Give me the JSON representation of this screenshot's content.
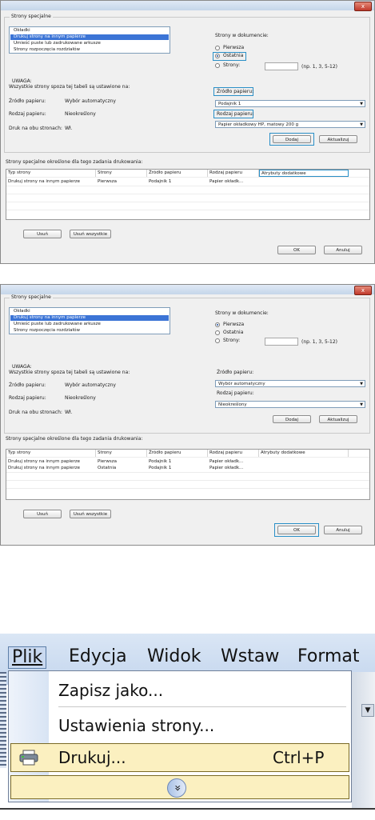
{
  "dialog": {
    "group_title": "Strony specjalne",
    "list_items": [
      "Okładki",
      "Drukuj strony na innym papierze",
      "Umieść puste lub zadrukowane arkusze",
      "Strony rozpoczęcia rozdziałów"
    ],
    "selected_index": 1,
    "pages_label": "Strony w dokumencie:",
    "radio_first": "Pierwsza",
    "radio_last": "Ostatnia",
    "radio_pages": "Strony:",
    "pages_hint": "(np. 1, 3, 5-12)",
    "note_title": "UWAGA:",
    "note_text": "Wszystkie strony spoza tej tabeli są ustawione na:",
    "source_label": "Źródło papieru:",
    "source_value": "Wybór automatyczny",
    "type_label": "Rodzaj papieru:",
    "type_value": "Nieokreślony",
    "duplex_label": "Druk na obu stronach:",
    "duplex_value": "Wł.",
    "paper_source_label": "Źródło papieru:",
    "paper_type_label": "Rodzaj papieru:",
    "add_button": "Dodaj",
    "update_button": "Aktualizuj",
    "table_caption": "Strony specjalne określone dla tego zadania drukowania:",
    "columns": [
      "Typ strony",
      "Strony",
      "Źródło papieru",
      "Rodzaj papieru",
      "Atrybuty dodatkowe"
    ],
    "remove_button": "Usuń",
    "remove_all_button": "Usuń wszystkie",
    "ok_button": "OK",
    "cancel_button": "Anuluj",
    "close_glyph": "x"
  },
  "dialog1": {
    "selected_radio": "Ostatnia",
    "source_combo": "Podajnik 1",
    "type_combo": "Papier okładkowy HP, matowy 200 g",
    "rows": [
      [
        "Drukuj strony na innym papierze",
        "Pierwsza",
        "Podajnik 1",
        "Papier okładk..."
      ]
    ]
  },
  "dialog2": {
    "selected_radio": "Pierwsza",
    "source_combo": "Wybór automatyczny",
    "type_combo": "Nieokreślony",
    "rows": [
      [
        "Drukuj strony na innym papierze",
        "Pierwsza",
        "Podajnik 1",
        "Papier okładk..."
      ],
      [
        "Drukuj strony na innym papierze",
        "Ostatnia",
        "Podajnik 1",
        "Papier okładk..."
      ]
    ]
  },
  "menu": {
    "bar_items": [
      "Plik",
      "Edycja",
      "Widok",
      "Wstaw",
      "Format"
    ],
    "items": [
      "Zapisz jako...",
      "Ustawienia strony...",
      "Drukuj..."
    ],
    "print_shortcut": "Ctrl+P",
    "expand_glyph": "»"
  }
}
